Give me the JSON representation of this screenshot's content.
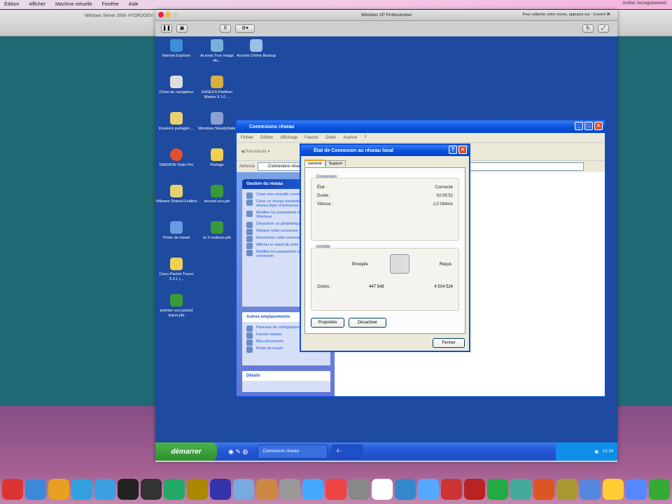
{
  "mac_menu": {
    "items": [
      "Édition",
      "Afficher",
      "Machine virtuelle",
      "Fenêtre",
      "Aide"
    ],
    "recording": "Arrêter l'enregistrement"
  },
  "left_window": {
    "title": "Windows Server 2008 -HYDROGEN"
  },
  "vm": {
    "title": "Windows XP Professionnel",
    "hint": "Pour relâcher votre souris, appuyez sur : Control ⌘"
  },
  "desktop_icons": [
    "Internet Explorer",
    "Acronis True Image Ho...",
    "Acronis Online Backup",
    "Choix de navigateur",
    "EASEUS Partition Master 9.1.0 ...",
    "Dossiers partagés ...",
    "Windows SteadyState",
    "DAEMON Tools Pro",
    "Partage",
    "VMware Shared Folders",
    "second eco.pkt",
    "Poste de travail",
    "la 3 routeurs.pkt",
    "Cisco Packet Tracer 5.3.1 (...",
    "premier eco packet tracer.pkt"
  ],
  "taskbar": {
    "start": "démarrer",
    "tasks": [
      "Connexions réseau",
      "6 -"
    ],
    "clock": "21:14"
  },
  "net_window": {
    "title": "Connexions réseau",
    "menu": [
      "Fichier",
      "Edition",
      "Affichage",
      "Favoris",
      "Outils",
      "Avancé",
      "?"
    ],
    "back": "Précédente",
    "address_label": "Adresse",
    "address": "Connexions réseau",
    "tasks_title": "Gestion du réseau",
    "tasks": [
      "Créer une nouvelle connexion",
      "Créer un réseau domestique ou un réseau léger d'entreprise",
      "Modifier les paramètres du Pare-feu Windows",
      "Désactiver ce périphérique réseau",
      "Réparer cette connexion",
      "Renommer cette connexion",
      "Afficher le statut de cette connexion",
      "Modifier les paramètres de cette connexion"
    ],
    "other_title": "Autres emplacements",
    "other": [
      "Panneau de configuration",
      "Favoris réseau",
      "Mes documents",
      "Poste de travail"
    ],
    "details_title": "Détails"
  },
  "dialog": {
    "title": "État de Connexion au réseau local",
    "tabs": [
      "Général",
      "Support"
    ],
    "connection_legend": "Connexion",
    "rows": [
      {
        "label": "État :",
        "value": "Connecté"
      },
      {
        "label": "Durée :",
        "value": "02:05:52"
      },
      {
        "label": "Vitesse :",
        "value": "1,0 Gbits/s"
      }
    ],
    "activity_legend": "Activité",
    "sent": "Envoyés",
    "received": "Reçus",
    "bytes_label": "Octets :",
    "bytes_sent": "447 548",
    "bytes_received": "4 504 524",
    "properties": "Propriétés",
    "disable": "Désactiver",
    "close": "Fermer"
  },
  "dock_colors": [
    "#d33",
    "#3a8ad8",
    "#e8a020",
    "#30a0e0",
    "#3aa0e0",
    "#222",
    "#333",
    "#2a6",
    "#a80",
    "#33a",
    "#7ad",
    "#c84",
    "#999",
    "#4af",
    "#e44",
    "#888",
    "#fff",
    "#38c",
    "#5af",
    "#c33",
    "#b22",
    "#2a4",
    "#4a9",
    "#d52",
    "#a93",
    "#58d",
    "#fc3",
    "#58f",
    "#3a3"
  ]
}
